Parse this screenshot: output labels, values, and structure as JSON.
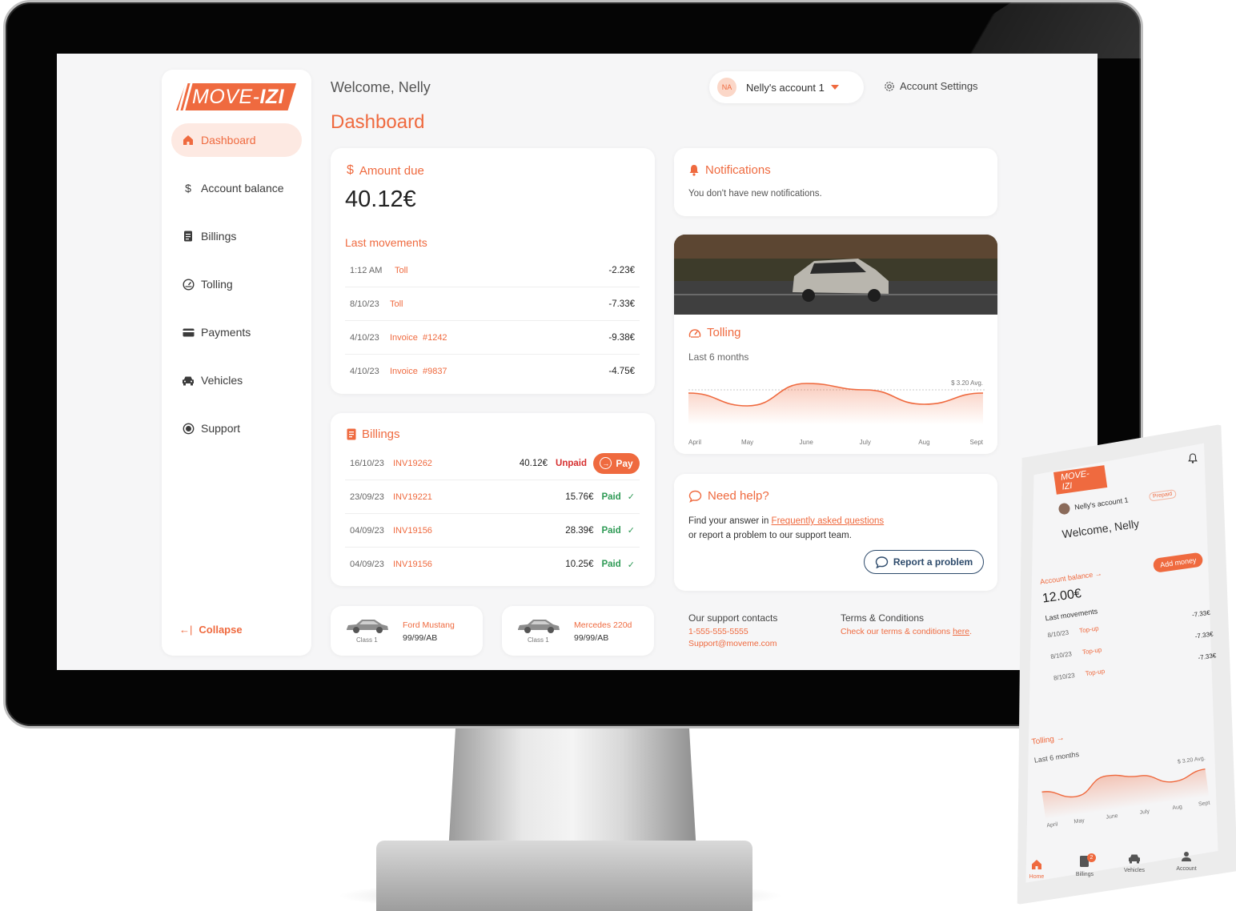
{
  "brand": {
    "logo_text_a": "MOVE-",
    "logo_text_b": "IZI",
    "accent_color": "#ef6a3f"
  },
  "sidebar": {
    "items": [
      {
        "label": "Dashboard",
        "icon": "home-icon",
        "active": true
      },
      {
        "label": "Account balance",
        "icon": "dollar-icon"
      },
      {
        "label": "Billings",
        "icon": "document-icon"
      },
      {
        "label": "Tolling",
        "icon": "speedometer-icon"
      },
      {
        "label": "Payments",
        "icon": "card-icon"
      },
      {
        "label": "Vehicles",
        "icon": "car-icon"
      },
      {
        "label": "Support",
        "icon": "headset-icon"
      }
    ],
    "collapse_label": "Collapse"
  },
  "header": {
    "welcome": "Welcome, Nelly",
    "title": "Dashboard",
    "avatar_initials": "NA",
    "account_label": "Nelly's account 1",
    "settings_label": "Account Settings"
  },
  "amount_due": {
    "title": "Amount due",
    "value": "40.12€",
    "movements_title": "Last movements",
    "movements": [
      {
        "date": "1:12 AM",
        "label": "Toll",
        "amount": "-2.23€"
      },
      {
        "date": "8/10/23",
        "label": "Toll",
        "amount": "-7.33€"
      },
      {
        "date": "4/10/23",
        "label": "Invoice  #1242",
        "amount": "-9.38€"
      },
      {
        "date": "4/10/23",
        "label": "Invoice  #9837",
        "amount": "-4.75€"
      }
    ]
  },
  "billings": {
    "title": "Billings",
    "pay_label": "Pay",
    "rows": [
      {
        "date": "16/10/23",
        "invoice": "INV19262",
        "amount": "40.12€",
        "status": "Unpaid"
      },
      {
        "date": "23/09/23",
        "invoice": "INV19221",
        "amount": "15.76€",
        "status": "Paid"
      },
      {
        "date": "04/09/23",
        "invoice": "INV19156",
        "amount": "28.39€",
        "status": "Paid"
      },
      {
        "date": "04/09/23",
        "invoice": "INV19156",
        "amount": "10.25€",
        "status": "Paid"
      }
    ]
  },
  "vehicles": [
    {
      "name": "Ford Mustang",
      "plate": "99/99/AB",
      "class": "Class 1"
    },
    {
      "name": "Mercedes 220d",
      "plate": "99/99/AB",
      "class": "Class 1"
    }
  ],
  "notifications": {
    "title": "Notifications",
    "text": "You don't have new notifications."
  },
  "tolling": {
    "title": "Tolling",
    "subtitle": "Last 6 months",
    "avg_label": "$ 3.20 Avg."
  },
  "help": {
    "title": "Need help?",
    "line1_prefix": "Find your answer in ",
    "faq_link": "Frequently asked questions",
    "line2": "or report a problem to our support team.",
    "report_label": "Report a problem"
  },
  "footer": {
    "contacts_title": "Our support contacts",
    "phone": "1-555-555-5555",
    "email": "Support@moveme.com",
    "terms_title": "Terms & Conditions",
    "terms_prefix": "Check our terms & conditions ",
    "terms_link": "here",
    "terms_suffix": "."
  },
  "chart_data": {
    "type": "area",
    "categories": [
      "April",
      "May",
      "June",
      "July",
      "Aug",
      "Sept"
    ],
    "values": [
      3.0,
      2.2,
      3.6,
      3.2,
      2.3,
      3.0
    ],
    "annotations": [
      "$ 3.20 Avg."
    ],
    "grid": false
  },
  "phone": {
    "logo_text": "MOVE-IZI",
    "account_label": "Nelly's account 1",
    "badge": "Prepaid",
    "welcome": "Welcome, Nelly",
    "balance_title": "Account balance →",
    "add_money": "Add money",
    "balance": "12.00€",
    "movements_title": "Last movements",
    "movements": [
      {
        "date": "8/10/23",
        "label": "Top-up",
        "amount": "-7.33€"
      },
      {
        "date": "8/10/23",
        "label": "Top-up",
        "amount": "-7.33€"
      },
      {
        "date": "8/10/23",
        "label": "Top-up",
        "amount": "-7.33€"
      }
    ],
    "tolling_title": "Tolling →",
    "tolling_sub": "Last 6 months",
    "avg_label": "$ 3.20 Avg.",
    "months": [
      "April",
      "May",
      "June",
      "July",
      "Aug",
      "Sept"
    ],
    "nav": [
      {
        "label": "Home",
        "icon": "home-icon"
      },
      {
        "label": "Billings",
        "icon": "document-icon"
      },
      {
        "label": "Vehicles",
        "icon": "car-icon"
      },
      {
        "label": "Account",
        "icon": "user-icon"
      }
    ],
    "billings_badge": "2"
  }
}
